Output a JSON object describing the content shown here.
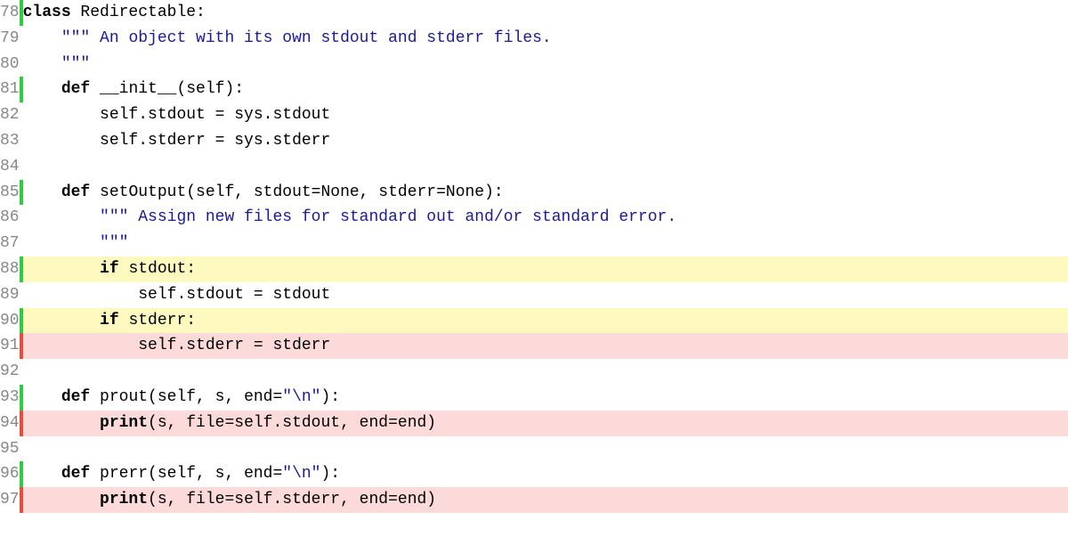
{
  "lines": [
    {
      "num": "78",
      "marker": "green",
      "hl": "",
      "indent": "",
      "tokens": [
        {
          "t": "class ",
          "c": "kw"
        },
        {
          "t": "Redirectable:",
          "c": "name"
        }
      ]
    },
    {
      "num": "79",
      "marker": "",
      "hl": "",
      "indent": "    ",
      "tokens": [
        {
          "t": "\"\"\" An object with its own stdout and stderr files.",
          "c": "str"
        }
      ]
    },
    {
      "num": "80",
      "marker": "",
      "hl": "",
      "indent": "    ",
      "tokens": [
        {
          "t": "\"\"\"",
          "c": "str"
        }
      ]
    },
    {
      "num": "81",
      "marker": "green",
      "hl": "",
      "indent": "    ",
      "tokens": [
        {
          "t": "def",
          "c": "kw"
        },
        {
          "t": " __init__(self):",
          "c": "name"
        }
      ]
    },
    {
      "num": "82",
      "marker": "",
      "hl": "",
      "indent": "        ",
      "tokens": [
        {
          "t": "self.stdout = sys.stdout",
          "c": "name"
        }
      ]
    },
    {
      "num": "83",
      "marker": "",
      "hl": "",
      "indent": "        ",
      "tokens": [
        {
          "t": "self.stderr = sys.stderr",
          "c": "name"
        }
      ]
    },
    {
      "num": "84",
      "marker": "",
      "hl": "",
      "indent": "",
      "tokens": [
        {
          "t": "",
          "c": "name"
        }
      ]
    },
    {
      "num": "85",
      "marker": "green",
      "hl": "",
      "indent": "    ",
      "tokens": [
        {
          "t": "def",
          "c": "kw"
        },
        {
          "t": " setOutput(self, stdout=None, stderr=None):",
          "c": "name"
        }
      ]
    },
    {
      "num": "86",
      "marker": "",
      "hl": "",
      "indent": "        ",
      "tokens": [
        {
          "t": "\"\"\" Assign new files for standard out and/or standard error.",
          "c": "str"
        }
      ]
    },
    {
      "num": "87",
      "marker": "",
      "hl": "",
      "indent": "        ",
      "tokens": [
        {
          "t": "\"\"\"",
          "c": "str"
        }
      ]
    },
    {
      "num": "88",
      "marker": "green",
      "hl": "hl-yellow",
      "indent": "        ",
      "tokens": [
        {
          "t": "if",
          "c": "kw"
        },
        {
          "t": " stdout:",
          "c": "name"
        }
      ]
    },
    {
      "num": "89",
      "marker": "",
      "hl": "",
      "indent": "            ",
      "tokens": [
        {
          "t": "self.stdout = stdout",
          "c": "name"
        }
      ]
    },
    {
      "num": "90",
      "marker": "green",
      "hl": "hl-yellow",
      "indent": "        ",
      "tokens": [
        {
          "t": "if",
          "c": "kw"
        },
        {
          "t": " stderr:",
          "c": "name"
        }
      ]
    },
    {
      "num": "91",
      "marker": "red",
      "hl": "hl-red",
      "indent": "            ",
      "tokens": [
        {
          "t": "self.stderr = stderr",
          "c": "name"
        }
      ]
    },
    {
      "num": "92",
      "marker": "",
      "hl": "",
      "indent": "",
      "tokens": [
        {
          "t": "",
          "c": "name"
        }
      ]
    },
    {
      "num": "93",
      "marker": "green",
      "hl": "",
      "indent": "    ",
      "tokens": [
        {
          "t": "def",
          "c": "kw"
        },
        {
          "t": " prout(self, s, end=",
          "c": "name"
        },
        {
          "t": "\"\\n\"",
          "c": "str"
        },
        {
          "t": "):",
          "c": "name"
        }
      ]
    },
    {
      "num": "94",
      "marker": "red",
      "hl": "hl-red",
      "indent": "        ",
      "tokens": [
        {
          "t": "print",
          "c": "kw"
        },
        {
          "t": "(s, file=self.stdout, end=end)",
          "c": "name"
        }
      ]
    },
    {
      "num": "95",
      "marker": "",
      "hl": "",
      "indent": "",
      "tokens": [
        {
          "t": "",
          "c": "name"
        }
      ]
    },
    {
      "num": "96",
      "marker": "green",
      "hl": "",
      "indent": "    ",
      "tokens": [
        {
          "t": "def",
          "c": "kw"
        },
        {
          "t": " prerr(self, s, end=",
          "c": "name"
        },
        {
          "t": "\"\\n\"",
          "c": "str"
        },
        {
          "t": "):",
          "c": "name"
        }
      ]
    },
    {
      "num": "97",
      "marker": "red",
      "hl": "hl-red",
      "indent": "        ",
      "tokens": [
        {
          "t": "print",
          "c": "kw"
        },
        {
          "t": "(s, file=self.stderr, end=end)",
          "c": "name"
        }
      ]
    }
  ]
}
